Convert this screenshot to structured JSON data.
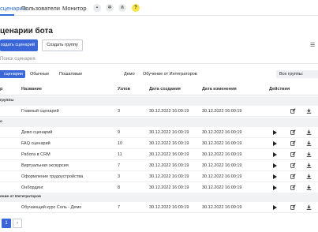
{
  "nav": {
    "tabs": [
      {
        "label": "сценарии"
      },
      {
        "label": "Пользователи"
      },
      {
        "label": "Монитор"
      }
    ],
    "icons": [
      "chat-icon",
      "gear-icon",
      "sitemap-icon",
      "help-icon"
    ],
    "help_glyph": "?",
    "accent": "#2f6fd9"
  },
  "page": {
    "title": "ценарии бота"
  },
  "toolbar": {
    "create_scenario": "оздать сценарий",
    "create_group": "Создать группу"
  },
  "search": {
    "placeholder": "Поиск сценария"
  },
  "filters": {
    "active": "сценарии",
    "items": [
      "Обычные",
      "Пошаговые",
      "Демо",
      "Обучение от Интеграторов"
    ],
    "groups_select": "Все группы:"
  },
  "table": {
    "headers": {
      "id": "р",
      "name": "Название",
      "nodes": "Узлов",
      "created": "Дата создания",
      "modified": "Дата изменения",
      "actions": "Действия"
    },
    "groups": [
      {
        "label": "группы"
      },
      {
        "label": "о"
      },
      {
        "label": "ение от Интеграторов"
      }
    ],
    "rows": [
      {
        "name": "Главный сценарий",
        "nodes": "3",
        "created": "30.12.2022 16:00:19",
        "modified": "30.12.2022 16:00:19"
      },
      {
        "name": "Демо сценарий",
        "nodes": "9",
        "created": "30.12.2022 16:00:19",
        "modified": "30.12.2022 16:00:19"
      },
      {
        "name": "FAQ сценарий",
        "nodes": "10",
        "created": "30.12.2022 16:00:19",
        "modified": "30.12.2022 16:00:19"
      },
      {
        "name": "Работа в CRM",
        "nodes": "11",
        "created": "30.12.2022 16:00:19",
        "modified": "30.12.2022 16:00:19"
      },
      {
        "name": "Виртуальная экскурсия",
        "nodes": "7",
        "created": "30.12.2022 16:00:19",
        "modified": "30.12.2022 16:00:19"
      },
      {
        "name": "Оформление трудоустройства",
        "nodes": "3",
        "created": "30.12.2022 16:00:19",
        "modified": "30.12.2022 16:00:19"
      },
      {
        "name": "Онбординг",
        "nodes": "8",
        "created": "30.12.2022 16:00:19",
        "modified": "30.12.2022 16:00:19"
      },
      {
        "name": "Обучающий курс Соль - Демо",
        "nodes": "7",
        "created": "30.12.2022 16:00:19",
        "modified": "30.12.2022 16:00:19"
      }
    ]
  },
  "pagination": {
    "current": "1",
    "next": "›"
  }
}
